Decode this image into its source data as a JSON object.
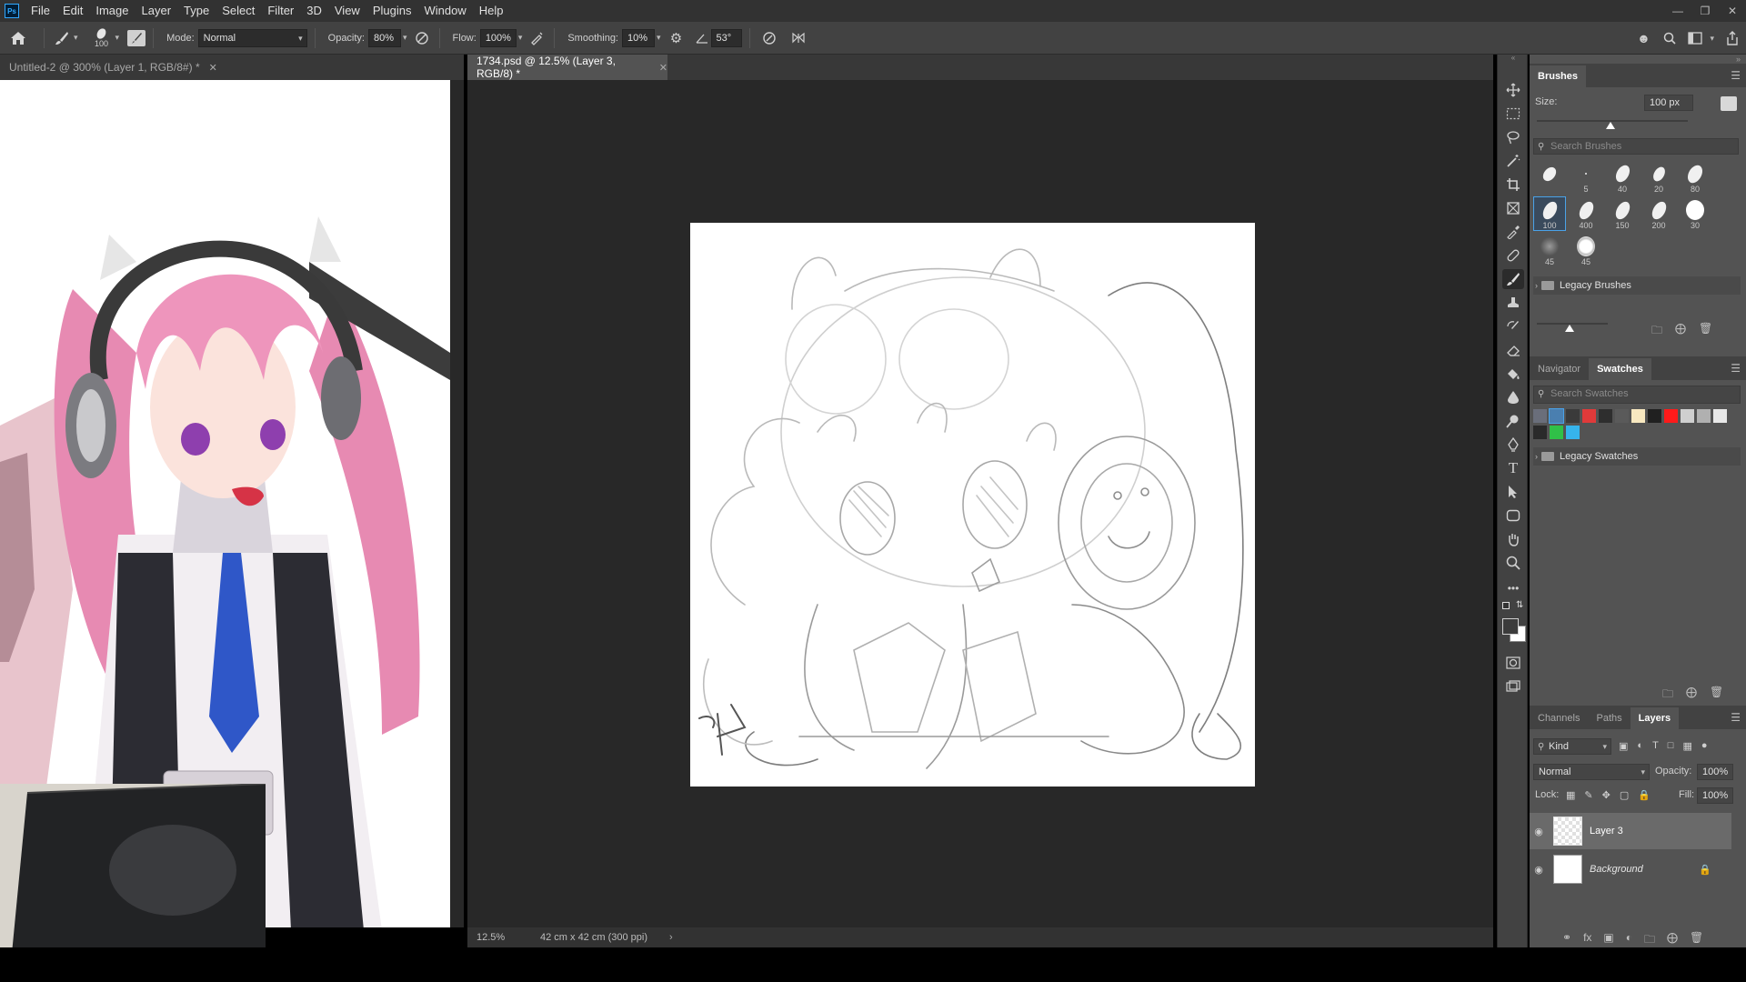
{
  "app": {
    "logo": "Ps",
    "menu": [
      "File",
      "Edit",
      "Image",
      "Layer",
      "Type",
      "Select",
      "Filter",
      "3D",
      "View",
      "Plugins",
      "Window",
      "Help"
    ]
  },
  "options_bar": {
    "brush_size": "100",
    "mode_label": "Mode:",
    "mode_value": "Normal",
    "opacity_label": "Opacity:",
    "opacity_value": "80%",
    "flow_label": "Flow:",
    "flow_value": "100%",
    "smoothing_label": "Smoothing:",
    "smoothing_value": "10%",
    "angle_value": "53°"
  },
  "tabs": [
    {
      "label": "Untitled-2 @ 300% (Layer 1, RGB/8#) *",
      "active": false
    },
    {
      "label": "1734.psd @ 12.5% (Layer 3, RGB/8) *",
      "active": true
    }
  ],
  "status_bar": {
    "zoom": "12.5%",
    "doc_info": "42 cm x 42 cm (300 ppi)"
  },
  "brushes_panel": {
    "tab": "Brushes",
    "size_label": "Size:",
    "size_value": "100 px",
    "search_placeholder": "Search Brushes",
    "presets": [
      {
        "label": ""
      },
      {
        "label": "5"
      },
      {
        "label": "40"
      },
      {
        "label": "20"
      },
      {
        "label": "80"
      },
      {
        "label": "100"
      },
      {
        "label": "400"
      },
      {
        "label": "150"
      },
      {
        "label": "200"
      },
      {
        "label": "30"
      },
      {
        "label": "45"
      },
      {
        "label": "45"
      }
    ],
    "folder": "Legacy Brushes"
  },
  "swatches_panel": {
    "tabs": [
      "Navigator",
      "Swatches"
    ],
    "active_tab": "Swatches",
    "search_placeholder": "Search Swatches",
    "colors": [
      "#6a6e7a",
      "#4a7fb0",
      "#3a3a3a",
      "#e03a3a",
      "#2e2e2e",
      "#5a5a5a",
      "#f8e8c0",
      "#202020",
      "#ff1a1a",
      "#cfcfcf",
      "#b0b0b0",
      "#e8e8e8",
      "#2a2a2a",
      "#30c048",
      "#36b4ec"
    ],
    "folder": "Legacy Swatches"
  },
  "layers_panel": {
    "tabs": [
      "Channels",
      "Paths",
      "Layers"
    ],
    "active_tab": "Layers",
    "filter_label": "Kind",
    "blend_mode": "Normal",
    "opacity_label": "Opacity:",
    "opacity_value": "100%",
    "lock_label": "Lock:",
    "fill_label": "Fill:",
    "fill_value": "100%",
    "layers": [
      {
        "name": "Layer 3",
        "selected": true
      },
      {
        "name": "Background",
        "selected": false
      }
    ]
  },
  "colors": {
    "accent": "#4aa2e8"
  }
}
